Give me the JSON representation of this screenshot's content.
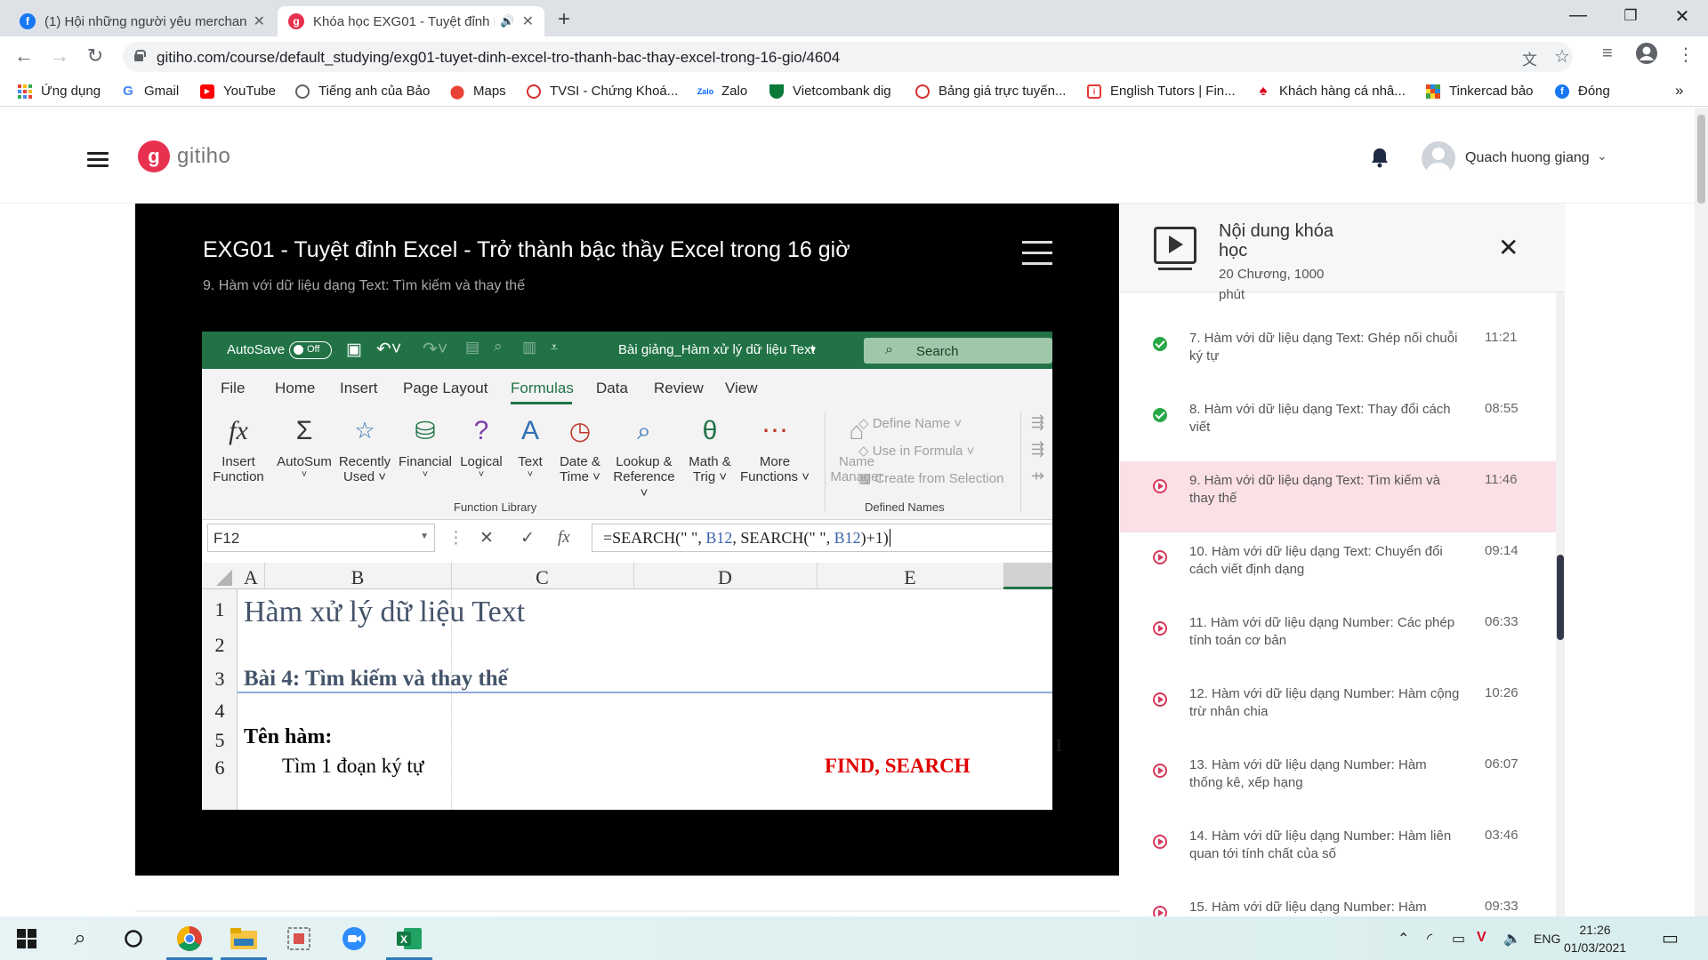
{
  "browser": {
    "tabs": [
      {
        "title": "(1) Hội những người yêu merchan",
        "favicon": "facebook-icon",
        "active": false
      },
      {
        "title": "Khóa học EXG01 - Tuyệt đỉnh Excel",
        "favicon": "gitiho-icon",
        "active": true
      }
    ],
    "url": "gitiho.com/course/default_studying/exg01-tuyet-dinh-excel-tro-thanh-bac-thay-excel-trong-16-gio/4604",
    "bookmarks": [
      {
        "label": "Ứng dụng",
        "icon": "apps-grid-icon"
      },
      {
        "label": "Gmail",
        "icon": "google-icon"
      },
      {
        "label": "YouTube",
        "icon": "youtube-icon"
      },
      {
        "label": "Tiếng anh của Bảo",
        "icon": "globe-icon"
      },
      {
        "label": "Maps",
        "icon": "maps-pin-icon"
      },
      {
        "label": "TVSI - Chứng Khoá...",
        "icon": "tvsi-icon"
      },
      {
        "label": "Zalo",
        "icon": "zalo-icon"
      },
      {
        "label": "Vietcombank dig",
        "icon": "vietcombank-icon"
      },
      {
        "label": "Bảng giá trực tuyến...",
        "icon": "tvsi-icon"
      },
      {
        "label": "English Tutors | Fin...",
        "icon": "tutor-icon"
      },
      {
        "label": "Khách hàng cá nhâ...",
        "icon": "maple-icon"
      },
      {
        "label": "Tinkercad bảo",
        "icon": "tinkercad-icon"
      },
      {
        "label": "Đóng",
        "icon": "facebook-icon"
      }
    ],
    "bookmarks_more": "»"
  },
  "site": {
    "logo_text": "gitiho",
    "user_name": "Quach huong giang",
    "brand_color": "#e8304f"
  },
  "player": {
    "course_title": "EXG01 - Tuyệt đỉnh Excel - Trở thành bậc thầy Excel trong 16 giờ",
    "lesson_subtitle": "9. Hàm với dữ liệu dạng Text: Tìm kiếm và thay thế",
    "excel": {
      "autosave_label": "AutoSave",
      "autosave_state": "Off",
      "file_name": "Bài giảng_Hàm xử lý dữ liệu Text",
      "search_label": "Search",
      "menu": [
        "File",
        "Home",
        "Insert",
        "Page Layout",
        "Formulas",
        "Data",
        "Review",
        "View"
      ],
      "active_menu": "Formulas",
      "ribbon_buttons": [
        {
          "line1": "Insert",
          "line2": "Function",
          "icon": "fx-icon"
        },
        {
          "line1": "AutoSum",
          "line2": "˅",
          "icon": "sigma-icon"
        },
        {
          "line1": "Recently",
          "line2": "Used ˅",
          "icon": "star-book-icon"
        },
        {
          "line1": "Financial",
          "line2": "˅",
          "icon": "financial-icon"
        },
        {
          "line1": "Logical",
          "line2": "˅",
          "icon": "logical-icon"
        },
        {
          "line1": "Text",
          "line2": "˅",
          "icon": "text-book-icon"
        },
        {
          "line1": "Date &",
          "line2": "Time ˅",
          "icon": "clock-book-icon"
        },
        {
          "line1": "Lookup &",
          "line2": "Reference ˅",
          "icon": "lookup-icon"
        },
        {
          "line1": "Math &",
          "line2": "Trig ˅",
          "icon": "theta-icon"
        },
        {
          "line1": "More",
          "line2": "Functions ˅",
          "icon": "more-functions-icon"
        },
        {
          "line1": "Name",
          "line2": "Manager",
          "icon": "name-manager-icon"
        }
      ],
      "defined_names_items": [
        "Define Name ˅",
        "Use in Formula ˅",
        "Create from Selection"
      ],
      "group_function_library": "Function Library",
      "group_defined_names": "Defined Names",
      "name_box": "F12",
      "formula": {
        "p1": "=SEARCH(\" \", ",
        "r1": "B12",
        "p2": ",  SEARCH(\" \", ",
        "r2": "B12",
        "p3": ")+1)"
      },
      "columns": [
        "A",
        "B",
        "C",
        "D",
        "E"
      ],
      "rows": [
        "1",
        "2",
        "3",
        "4",
        "5",
        "6"
      ],
      "cells": {
        "b1": "Hàm xử lý dữ liệu Text",
        "b3": "Bài 4: Tìm kiếm và thay thế",
        "b5": "Tên hàm:",
        "b6": "Tìm 1 đoạn ký tự",
        "e6": "FIND, SEARCH"
      },
      "accent_color": "#217346"
    }
  },
  "sidebar": {
    "title": "Nội dung khóa học",
    "meta": "20 Chương, 1000 phút",
    "lessons": [
      {
        "title": "7. Hàm với dữ liệu dạng Text: Ghép nối chuỗi ký tự",
        "duration": "11:21",
        "status": "done"
      },
      {
        "title": "8. Hàm với dữ liệu dạng Text: Thay đổi cách viết",
        "duration": "08:55",
        "status": "done"
      },
      {
        "title": "9. Hàm với dữ liệu dạng Text: Tìm kiếm và thay thế",
        "duration": "11:46",
        "status": "playing"
      },
      {
        "title": "10. Hàm với dữ liệu dạng Text: Chuyển đổi cách viết định dạng",
        "duration": "09:14",
        "status": "pending"
      },
      {
        "title": "11. Hàm với dữ liệu dạng Number: Các phép tính toán cơ bản",
        "duration": "06:33",
        "status": "pending"
      },
      {
        "title": "12. Hàm với dữ liệu dạng Number: Hàm cộng trừ nhân chia",
        "duration": "10:26",
        "status": "pending"
      },
      {
        "title": "13. Hàm với dữ liệu dạng Number: Hàm thống kê, xếp hạng",
        "duration": "06:07",
        "status": "pending"
      },
      {
        "title": "14. Hàm với dữ liệu dạng Number: Hàm liên quan tới tính chất của số",
        "duration": "03:46",
        "status": "pending"
      },
      {
        "title": "15. Hàm với dữ liệu dạng Number: Hàm",
        "duration": "09:33",
        "status": "pending"
      }
    ],
    "active_color": "#fbe0e6"
  },
  "taskbar": {
    "apps": [
      "windows-start-icon",
      "search-icon",
      "cortana-icon",
      "chrome-icon",
      "file-explorer-icon",
      "snipping-tool-icon",
      "zoom-icon",
      "excel-icon"
    ],
    "language": "ENG",
    "time": "21:26",
    "date": "01/03/2021"
  }
}
